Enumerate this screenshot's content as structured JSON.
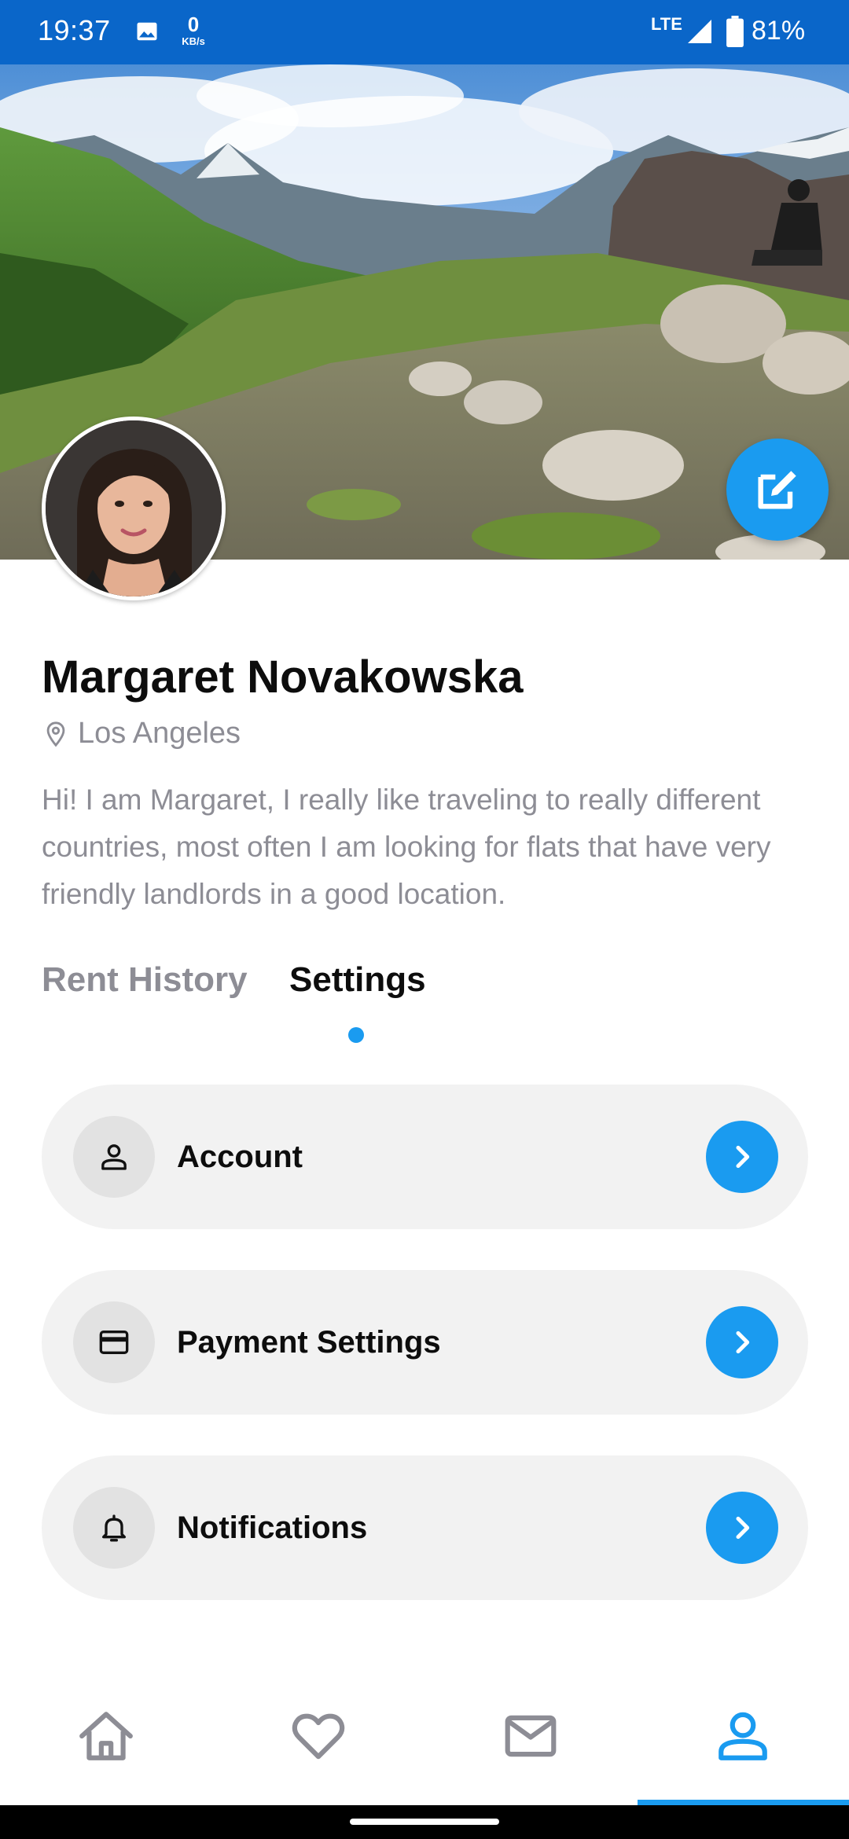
{
  "status_bar": {
    "time": "19:37",
    "speed_value": "0",
    "speed_unit": "KB/s",
    "network": "LTE",
    "battery": "81%",
    "icons": [
      "gallery-icon",
      "signal-icon",
      "battery-icon"
    ]
  },
  "profile": {
    "name": "Margaret Novakowska",
    "location": "Los Angeles",
    "bio": "Hi! I am Margaret, I really like traveling to really different countries, most often I am looking for flats that have very friendly landlords in a good location."
  },
  "tabs": [
    {
      "label": "Rent History",
      "active": false
    },
    {
      "label": "Settings",
      "active": true
    }
  ],
  "settings": [
    {
      "label": "Account",
      "icon": "person-icon"
    },
    {
      "label": "Payment Settings",
      "icon": "credit-card-icon"
    },
    {
      "label": "Notifications",
      "icon": "bell-icon"
    }
  ],
  "bottom_nav": [
    {
      "icon": "home-icon",
      "active": false
    },
    {
      "icon": "heart-icon",
      "active": false
    },
    {
      "icon": "mail-icon",
      "active": false
    },
    {
      "icon": "profile-icon",
      "active": true
    }
  ],
  "colors": {
    "accent": "#1a9bf0",
    "status_bar": "#0a66c9",
    "muted_text": "#8d8d95",
    "card_bg": "#f2f2f2"
  }
}
